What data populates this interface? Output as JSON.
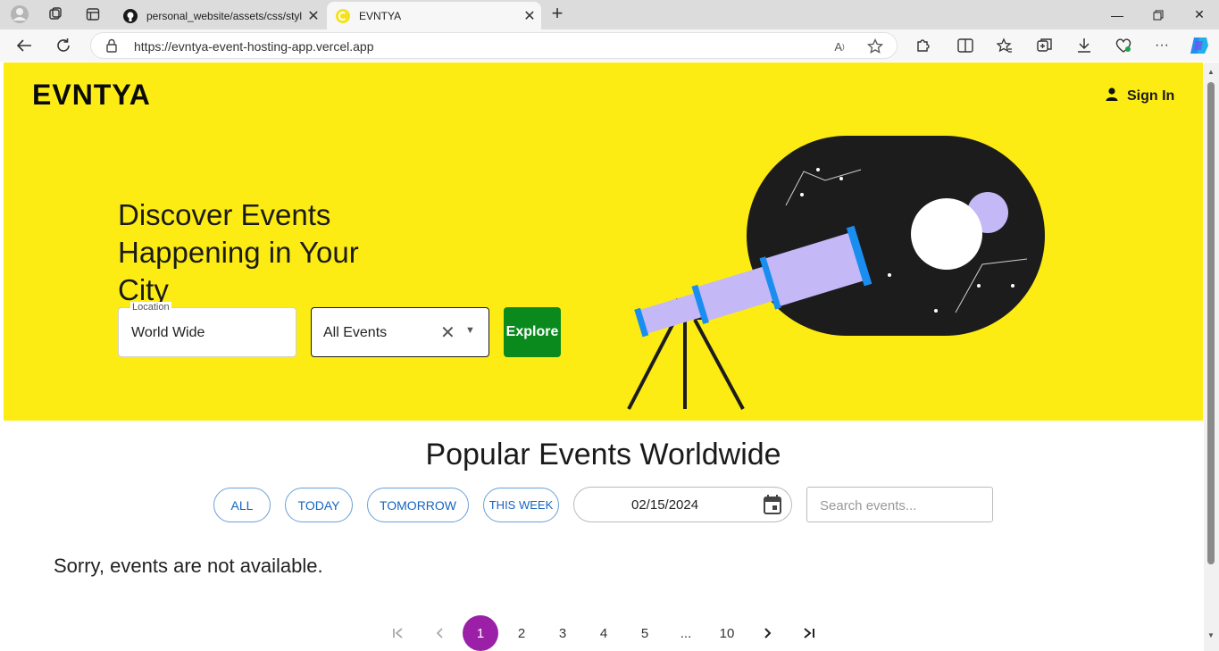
{
  "browser": {
    "tabs": [
      {
        "title": "personal_website/assets/css/style",
        "active": false
      },
      {
        "title": "EVNTYA",
        "active": true
      }
    ],
    "url": "https://evntya-event-hosting-app.vercel.app"
  },
  "header": {
    "logo": "EVNTYA",
    "signin_label": "Sign In"
  },
  "hero": {
    "headline": "Discover Events Happening in Your City",
    "location": {
      "label": "Location",
      "value": "World Wide"
    },
    "category": {
      "value": "All Events"
    },
    "explore_label": "Explore"
  },
  "events": {
    "title": "Popular Events Worldwide",
    "filters": [
      "ALL",
      "TODAY",
      "TOMORROW",
      "THIS WEEK"
    ],
    "date": "02/15/2024",
    "search_placeholder": "Search events...",
    "empty_message": "Sorry, events are not available."
  },
  "pagination": {
    "pages": [
      "1",
      "2",
      "3",
      "4",
      "5",
      "...",
      "10"
    ],
    "current": "1"
  },
  "colors": {
    "hero_bg": "#fdec13",
    "explore": "#0a8a1c",
    "active_page": "#9c1fa8",
    "chip_text": "#1565c0"
  }
}
